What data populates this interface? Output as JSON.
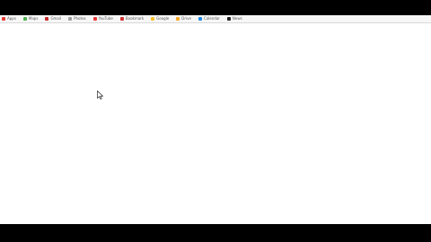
{
  "bookmarks": [
    {
      "label": "Apps",
      "icon": "apps-grid-icon",
      "color": "#e53935"
    },
    {
      "label": "Maps",
      "icon": "maps-icon",
      "color": "#4caf50"
    },
    {
      "label": "Gmail",
      "icon": "mail-icon",
      "color": "#c62828"
    },
    {
      "label": "Photos",
      "icon": "folder-icon",
      "color": "#9e9e9e"
    },
    {
      "label": "YouTube",
      "icon": "youtube-icon",
      "color": "#e53935"
    },
    {
      "label": "Bookmark",
      "icon": "bookmark-icon",
      "color": "#d32f2f"
    },
    {
      "label": "Google",
      "icon": "google-icon",
      "color": "#fbc02d"
    },
    {
      "label": "Drive",
      "icon": "drive-icon",
      "color": "#f9a825"
    },
    {
      "label": "Calendar",
      "icon": "calendar-icon",
      "color": "#1e88e5"
    },
    {
      "label": "News",
      "icon": "news-icon",
      "color": "#212121"
    }
  ],
  "colors": {
    "bar_bg": "#f7f7f7",
    "page_bg": "#ffffff",
    "letterbox": "#000000"
  }
}
